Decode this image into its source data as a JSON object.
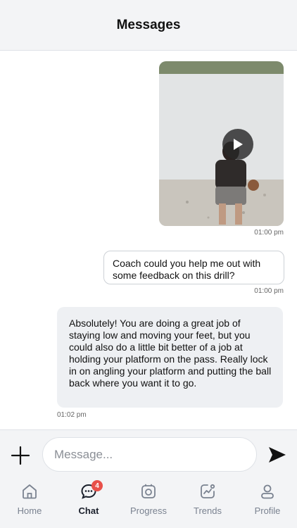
{
  "header": {
    "title": "Messages"
  },
  "messages": [
    {
      "type": "video",
      "direction": "outgoing",
      "timestamp": "01:00 pm"
    },
    {
      "type": "text",
      "direction": "outgoing",
      "text": "Coach could you help me out with some feedback on this drill?",
      "timestamp": "01:00 pm"
    },
    {
      "type": "text",
      "direction": "incoming",
      "text": "Absolutely! You are doing a great job of staying low and moving your feet, but you could also do a little bit better of a job at holding your platform on the pass. Really lock in on angling your platform and putting the ball back where you want it to go.",
      "timestamp": "01:02 pm"
    }
  ],
  "composer": {
    "placeholder": "Message..."
  },
  "tabs": [
    {
      "label": "Home",
      "icon": "home-icon",
      "active": false
    },
    {
      "label": "Chat",
      "icon": "chat-icon",
      "active": true,
      "badge": "4"
    },
    {
      "label": "Progress",
      "icon": "progress-icon",
      "active": false
    },
    {
      "label": "Trends",
      "icon": "trends-icon",
      "active": false
    },
    {
      "label": "Profile",
      "icon": "profile-icon",
      "active": false
    }
  ],
  "colors": {
    "accent_badge": "#e8504a",
    "active_tab": "#1a1f2b",
    "inactive_tab": "#7a8290"
  }
}
